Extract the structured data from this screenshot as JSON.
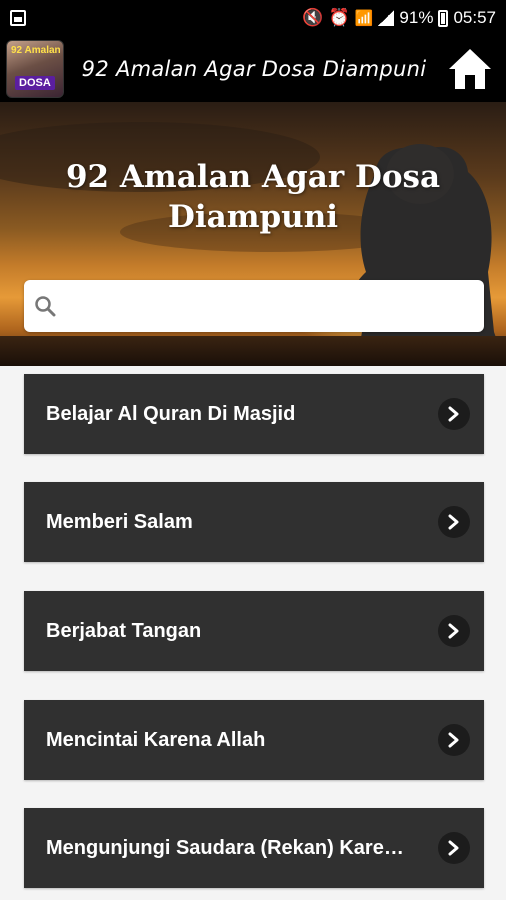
{
  "status_bar": {
    "battery": "91%",
    "time": "05:57"
  },
  "app_bar": {
    "title": "92 Amalan Agar Dosa Diampuni",
    "icon_text_top": "92 Amalan",
    "icon_text_bottom": "DOSA"
  },
  "banner": {
    "title": "92 Amalan Agar Dosa Diampuni"
  },
  "search": {
    "value": "",
    "placeholder": ""
  },
  "items": [
    {
      "label": "Belajar Al Quran Di Masjid"
    },
    {
      "label": "Memberi Salam"
    },
    {
      "label": "Berjabat Tangan"
    },
    {
      "label": "Mencintai Karena Allah"
    },
    {
      "label": "Mengunjungi Saudara (Rekan) Kare…"
    }
  ],
  "icons": {
    "home": "home-icon",
    "search": "search-icon",
    "chevron": "chevron-right-icon"
  },
  "colors": {
    "app_bar": "#000000",
    "list_item": "#303030",
    "list_bg": "#f4f4f4"
  }
}
